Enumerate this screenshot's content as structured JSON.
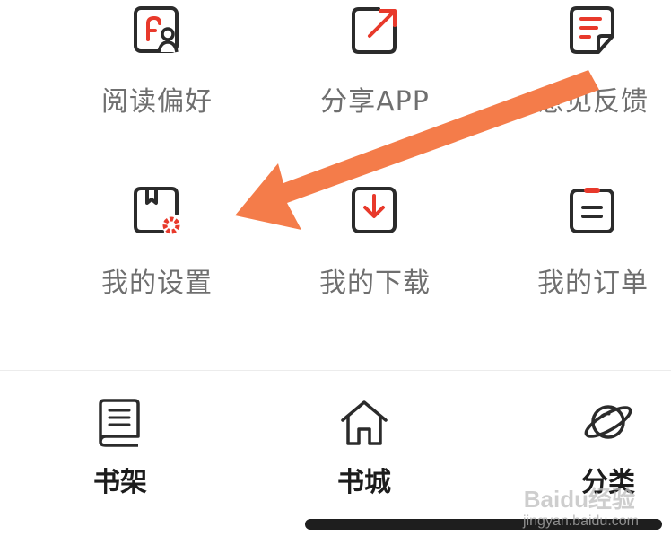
{
  "menu": {
    "row1": [
      {
        "label": "阅读偏好",
        "icon": "reading-preference-icon"
      },
      {
        "label": "分享APP",
        "icon": "share-app-icon"
      },
      {
        "label": "意见反馈",
        "icon": "feedback-icon"
      }
    ],
    "row2": [
      {
        "label": "我的设置",
        "icon": "my-settings-icon"
      },
      {
        "label": "我的下载",
        "icon": "my-downloads-icon"
      },
      {
        "label": "我的订单",
        "icon": "my-orders-icon"
      }
    ]
  },
  "tabbar": {
    "items": [
      {
        "label": "书架",
        "icon": "bookshelf-icon"
      },
      {
        "label": "书城",
        "icon": "bookstore-home-icon"
      },
      {
        "label": "分类",
        "icon": "category-planet-icon"
      }
    ]
  },
  "watermark": {
    "brand": "Baidu经验",
    "url": "jingyan.baidu.com"
  },
  "colors": {
    "accent_red": "#e8392b",
    "icon_dark": "#2b2b2b",
    "label_gray": "#6f6f6f",
    "annotation_arrow": "#f47c4a"
  }
}
